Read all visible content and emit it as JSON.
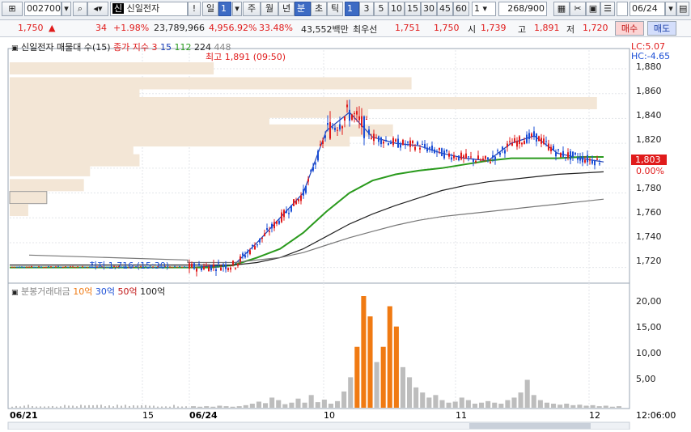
{
  "toolbar": {
    "code": "002700",
    "badge": "신",
    "stock_name": "신일전자",
    "periods": [
      "일",
      "1",
      "주",
      "월",
      "년",
      "분",
      "초",
      "틱"
    ],
    "minute_options": [
      "1",
      "3",
      "5",
      "10",
      "15",
      "30",
      "45",
      "60"
    ],
    "count_value": "1",
    "range": "268/900",
    "date": "06/24"
  },
  "info": {
    "price": "1,750",
    "arrow": "▲",
    "change": "34",
    "change_pct": "+1.98%",
    "volume": "23,789,966",
    "vol_ratio": "4,956.92%",
    "turnover": "33.48%",
    "amount": "43,552백만",
    "best_ask_label": "최우선",
    "best_ask": "1,751",
    "best_bid": "1,750",
    "open_label": "시",
    "open": "1,739",
    "high_label": "고",
    "high": "1,891",
    "low_label": "저",
    "low": "1,720",
    "buy_label": "매수",
    "sell_label": "매도"
  },
  "price_panel": {
    "title": "신일전자 매물대 수(15)",
    "ma_label": "종가 지수 3",
    "ma_periods": [
      "15",
      "112",
      "224",
      "448"
    ],
    "lc": "LC:5.07",
    "hc": "HC:-4.65",
    "high_annot": "최고 1,891 (09:50)",
    "low_annot": "최저 1,716 (15:30)",
    "current_price_tag": "1,803",
    "current_pct_tag": "0.00%",
    "y_ticks": [
      "1,880",
      "1,860",
      "1,840",
      "1,820",
      "1,800",
      "1,780",
      "1,760",
      "1,740",
      "1,720"
    ]
  },
  "volume_panel": {
    "title": "분봉거래대금",
    "thresholds": [
      "10억",
      "30억",
      "50억",
      "100억"
    ],
    "y_ticks": [
      "20,00",
      "15,00",
      "10,00",
      "5,00"
    ]
  },
  "x_axis": {
    "labels": [
      "06/21",
      "15",
      "06/24",
      "10",
      "11",
      "12"
    ],
    "time": "12:06:00"
  },
  "colors": {
    "up": "#e01b1b",
    "down": "#1b4fd6",
    "ma15": "#1a3fb8",
    "ma112": "#2a9a1d",
    "ma224": "#222222",
    "ma448": "#777777",
    "volume_profile": "#f3e6d6",
    "volume_bar": "#bdbdbd",
    "volume_high": "#f07a12"
  },
  "chart_data": [
    {
      "type": "line",
      "title": "신일전자 매물대 수(15)",
      "series": [
        {
          "name": "15",
          "values": [
            1720,
            1721,
            1722,
            1740,
            1760,
            1780,
            1830,
            1845,
            1825,
            1820,
            1818,
            1812,
            1808,
            1806,
            1820,
            1826,
            1812,
            1808,
            1805
          ]
        },
        {
          "name": "112",
          "values": [
            1720,
            1720,
            1722,
            1728,
            1735,
            1748,
            1765,
            1780,
            1790,
            1795,
            1798,
            1800,
            1803,
            1806,
            1808,
            1808,
            1808,
            1809,
            1809
          ]
        },
        {
          "name": "224",
          "values": [
            1722,
            1722,
            1722,
            1724,
            1728,
            1735,
            1745,
            1755,
            1763,
            1770,
            1776,
            1782,
            1786,
            1789,
            1791,
            1793,
            1795,
            1796,
            1797
          ]
        },
        {
          "name": "448",
          "values": [
            1724,
            1724,
            1724,
            1726,
            1728,
            1732,
            1738,
            1744,
            1749,
            1754,
            1758,
            1761,
            1763,
            1765,
            1767,
            1769,
            1771,
            1773,
            1775
          ]
        }
      ],
      "ylim": [
        1710,
        1895
      ]
    },
    {
      "type": "bar",
      "title": "분봉거래대금",
      "values": [
        0.3,
        0.2,
        0.3,
        0.2,
        0.4,
        0.3,
        0.2,
        0.3,
        0.5,
        0.8,
        1.2,
        0.9,
        2.0,
        1.5,
        0.7,
        1.0,
        1.8,
        1.0,
        2.5,
        1.1,
        1.6,
        0.8,
        1.3,
        3.2,
        6.0,
        12.0,
        22.0,
        18.0,
        9.0,
        12.0,
        20.0,
        16.0,
        8.0,
        6.0,
        4.0,
        3.0,
        2.0,
        2.5,
        1.5,
        1.0,
        1.2,
        2.0,
        1.5,
        0.8,
        1.0,
        1.3,
        1.0,
        0.8,
        1.5,
        2.0,
        3.0,
        5.5,
        2.5,
        1.5,
        1.0,
        0.8,
        0.6,
        0.8,
        0.5,
        0.6,
        0.4,
        0.5,
        0.3,
        0.4,
        0.2,
        0.3
      ],
      "ylim": [
        0,
        22
      ]
    }
  ]
}
